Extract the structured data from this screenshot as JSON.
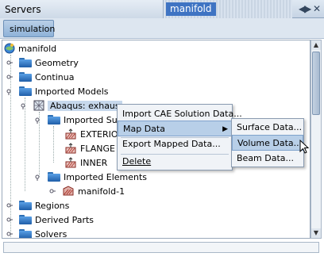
{
  "titlebar": {
    "servers_tab": "Servers",
    "active_tab": "manifold",
    "controls": [
      "◀",
      "▶",
      "✕"
    ]
  },
  "toolbar": {
    "sim_tab": "simulation"
  },
  "tree": {
    "root": "manifold",
    "items": [
      {
        "label": "Geometry"
      },
      {
        "label": "Continua"
      },
      {
        "label": "Imported Models"
      },
      {
        "label": "Abaqus: exhaus"
      },
      {
        "label": "Imported Sur"
      },
      {
        "label": "EXTERIO"
      },
      {
        "label": "FLANGE"
      },
      {
        "label": "INNER"
      },
      {
        "label": "Imported Elements"
      },
      {
        "label": "manifold-1"
      },
      {
        "label": "Regions"
      },
      {
        "label": "Derived Parts"
      },
      {
        "label": "Solvers"
      }
    ]
  },
  "context_menu": {
    "items": [
      "Import CAE Solution Data...",
      "Map Data",
      "Export Mapped Data...",
      "Delete"
    ]
  },
  "submenu": {
    "items": [
      "Surface Data...",
      "Volume Data...",
      "Beam Data..."
    ]
  }
}
